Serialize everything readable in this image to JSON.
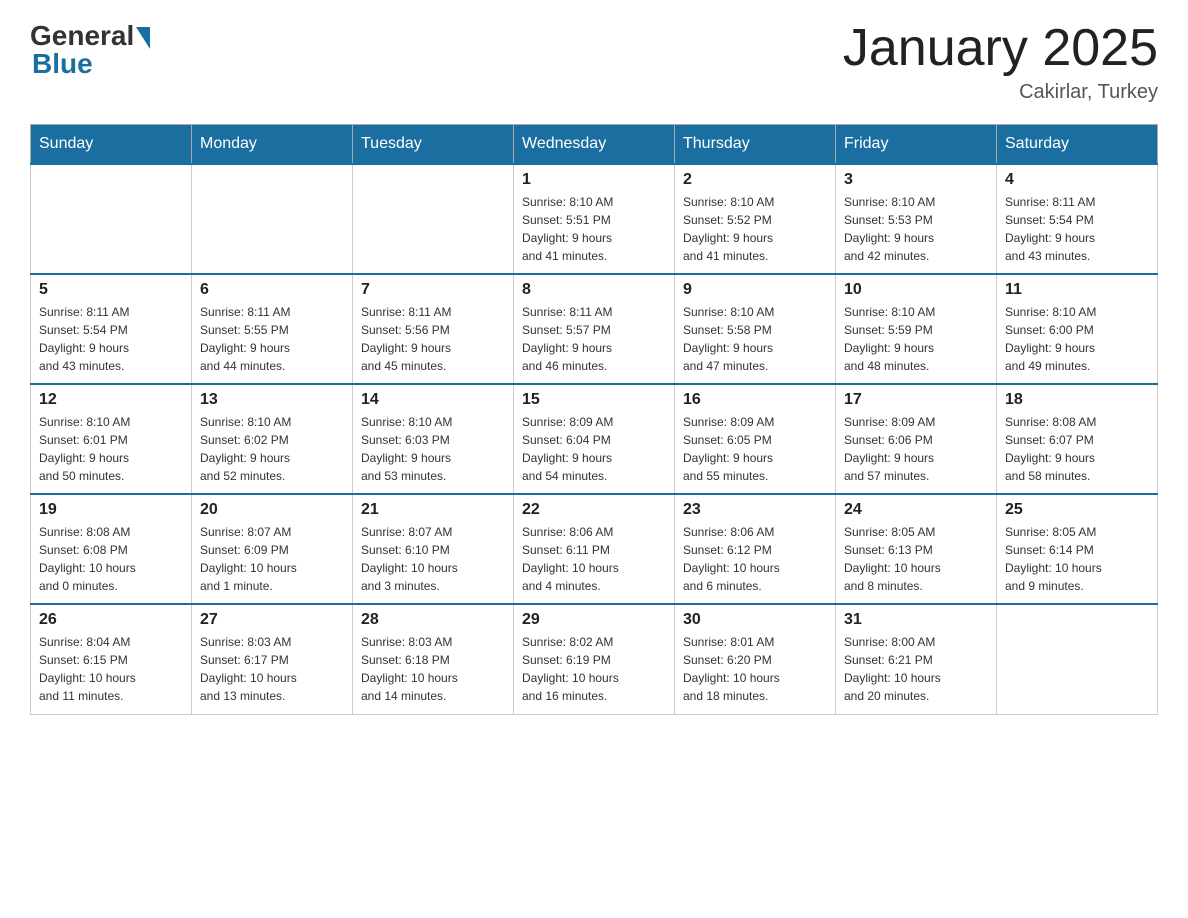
{
  "header": {
    "logo_general": "General",
    "logo_blue": "Blue",
    "month_title": "January 2025",
    "location": "Cakirlar, Turkey"
  },
  "weekdays": [
    "Sunday",
    "Monday",
    "Tuesday",
    "Wednesday",
    "Thursday",
    "Friday",
    "Saturday"
  ],
  "weeks": [
    [
      {
        "day": "",
        "info": ""
      },
      {
        "day": "",
        "info": ""
      },
      {
        "day": "",
        "info": ""
      },
      {
        "day": "1",
        "info": "Sunrise: 8:10 AM\nSunset: 5:51 PM\nDaylight: 9 hours\nand 41 minutes."
      },
      {
        "day": "2",
        "info": "Sunrise: 8:10 AM\nSunset: 5:52 PM\nDaylight: 9 hours\nand 41 minutes."
      },
      {
        "day": "3",
        "info": "Sunrise: 8:10 AM\nSunset: 5:53 PM\nDaylight: 9 hours\nand 42 minutes."
      },
      {
        "day": "4",
        "info": "Sunrise: 8:11 AM\nSunset: 5:54 PM\nDaylight: 9 hours\nand 43 minutes."
      }
    ],
    [
      {
        "day": "5",
        "info": "Sunrise: 8:11 AM\nSunset: 5:54 PM\nDaylight: 9 hours\nand 43 minutes."
      },
      {
        "day": "6",
        "info": "Sunrise: 8:11 AM\nSunset: 5:55 PM\nDaylight: 9 hours\nand 44 minutes."
      },
      {
        "day": "7",
        "info": "Sunrise: 8:11 AM\nSunset: 5:56 PM\nDaylight: 9 hours\nand 45 minutes."
      },
      {
        "day": "8",
        "info": "Sunrise: 8:11 AM\nSunset: 5:57 PM\nDaylight: 9 hours\nand 46 minutes."
      },
      {
        "day": "9",
        "info": "Sunrise: 8:10 AM\nSunset: 5:58 PM\nDaylight: 9 hours\nand 47 minutes."
      },
      {
        "day": "10",
        "info": "Sunrise: 8:10 AM\nSunset: 5:59 PM\nDaylight: 9 hours\nand 48 minutes."
      },
      {
        "day": "11",
        "info": "Sunrise: 8:10 AM\nSunset: 6:00 PM\nDaylight: 9 hours\nand 49 minutes."
      }
    ],
    [
      {
        "day": "12",
        "info": "Sunrise: 8:10 AM\nSunset: 6:01 PM\nDaylight: 9 hours\nand 50 minutes."
      },
      {
        "day": "13",
        "info": "Sunrise: 8:10 AM\nSunset: 6:02 PM\nDaylight: 9 hours\nand 52 minutes."
      },
      {
        "day": "14",
        "info": "Sunrise: 8:10 AM\nSunset: 6:03 PM\nDaylight: 9 hours\nand 53 minutes."
      },
      {
        "day": "15",
        "info": "Sunrise: 8:09 AM\nSunset: 6:04 PM\nDaylight: 9 hours\nand 54 minutes."
      },
      {
        "day": "16",
        "info": "Sunrise: 8:09 AM\nSunset: 6:05 PM\nDaylight: 9 hours\nand 55 minutes."
      },
      {
        "day": "17",
        "info": "Sunrise: 8:09 AM\nSunset: 6:06 PM\nDaylight: 9 hours\nand 57 minutes."
      },
      {
        "day": "18",
        "info": "Sunrise: 8:08 AM\nSunset: 6:07 PM\nDaylight: 9 hours\nand 58 minutes."
      }
    ],
    [
      {
        "day": "19",
        "info": "Sunrise: 8:08 AM\nSunset: 6:08 PM\nDaylight: 10 hours\nand 0 minutes."
      },
      {
        "day": "20",
        "info": "Sunrise: 8:07 AM\nSunset: 6:09 PM\nDaylight: 10 hours\nand 1 minute."
      },
      {
        "day": "21",
        "info": "Sunrise: 8:07 AM\nSunset: 6:10 PM\nDaylight: 10 hours\nand 3 minutes."
      },
      {
        "day": "22",
        "info": "Sunrise: 8:06 AM\nSunset: 6:11 PM\nDaylight: 10 hours\nand 4 minutes."
      },
      {
        "day": "23",
        "info": "Sunrise: 8:06 AM\nSunset: 6:12 PM\nDaylight: 10 hours\nand 6 minutes."
      },
      {
        "day": "24",
        "info": "Sunrise: 8:05 AM\nSunset: 6:13 PM\nDaylight: 10 hours\nand 8 minutes."
      },
      {
        "day": "25",
        "info": "Sunrise: 8:05 AM\nSunset: 6:14 PM\nDaylight: 10 hours\nand 9 minutes."
      }
    ],
    [
      {
        "day": "26",
        "info": "Sunrise: 8:04 AM\nSunset: 6:15 PM\nDaylight: 10 hours\nand 11 minutes."
      },
      {
        "day": "27",
        "info": "Sunrise: 8:03 AM\nSunset: 6:17 PM\nDaylight: 10 hours\nand 13 minutes."
      },
      {
        "day": "28",
        "info": "Sunrise: 8:03 AM\nSunset: 6:18 PM\nDaylight: 10 hours\nand 14 minutes."
      },
      {
        "day": "29",
        "info": "Sunrise: 8:02 AM\nSunset: 6:19 PM\nDaylight: 10 hours\nand 16 minutes."
      },
      {
        "day": "30",
        "info": "Sunrise: 8:01 AM\nSunset: 6:20 PM\nDaylight: 10 hours\nand 18 minutes."
      },
      {
        "day": "31",
        "info": "Sunrise: 8:00 AM\nSunset: 6:21 PM\nDaylight: 10 hours\nand 20 minutes."
      },
      {
        "day": "",
        "info": ""
      }
    ]
  ]
}
